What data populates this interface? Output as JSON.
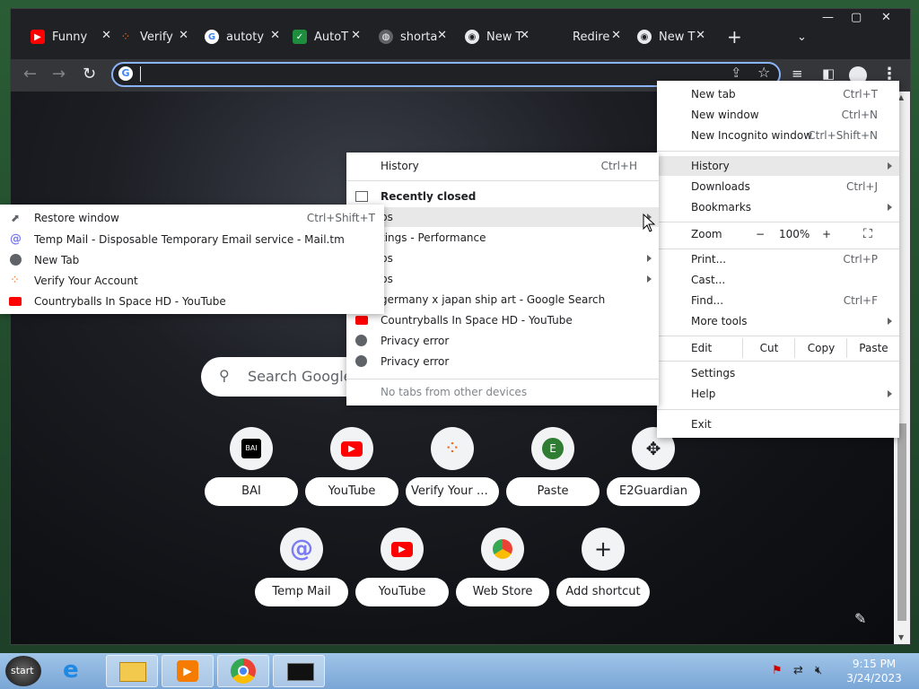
{
  "tabs": [
    {
      "title": "Funny",
      "favicon": "youtube-icon"
    },
    {
      "title": "Verify",
      "favicon": "verify-icon"
    },
    {
      "title": "autoty",
      "favicon": "google-icon"
    },
    {
      "title": "AutoT",
      "favicon": "autot-icon"
    },
    {
      "title": "shorta",
      "favicon": "globe-icon"
    },
    {
      "title": "New T",
      "favicon": "chrome-icon"
    },
    {
      "title": "Redire",
      "favicon": ""
    },
    {
      "title": "New T",
      "favicon": "chrome-icon"
    }
  ],
  "omnibox": {
    "value": ""
  },
  "search": {
    "placeholder": "Search Google o"
  },
  "shortcuts": [
    {
      "label": "BAI",
      "icon": "bai-icon"
    },
    {
      "label": "YouTube",
      "icon": "youtube-icon"
    },
    {
      "label": "Verify Your A...",
      "icon": "verify-icon"
    },
    {
      "label": "Paste",
      "icon": "e-icon",
      "icon_text": "E"
    },
    {
      "label": "E2Guardian",
      "icon": "e2guardian-icon"
    },
    {
      "label": "Temp Mail",
      "icon": "at-icon"
    },
    {
      "label": "YouTube",
      "icon": "youtube-icon"
    },
    {
      "label": "Web Store",
      "icon": "webstore-icon"
    },
    {
      "label": "Add shortcut",
      "icon": "plus-icon"
    }
  ],
  "main_menu": {
    "items": [
      {
        "label": "New tab",
        "shortcut": "Ctrl+T"
      },
      {
        "label": "New window",
        "shortcut": "Ctrl+N"
      },
      {
        "label": "New Incognito window",
        "shortcut": "Ctrl+Shift+N"
      },
      {
        "label": "History",
        "shortcut": ""
      },
      {
        "label": "Downloads",
        "shortcut": "Ctrl+J"
      },
      {
        "label": "Bookmarks",
        "shortcut": ""
      },
      {
        "label": "Print...",
        "shortcut": "Ctrl+P"
      },
      {
        "label": "Cast...",
        "shortcut": ""
      },
      {
        "label": "Find...",
        "shortcut": "Ctrl+F"
      },
      {
        "label": "More tools",
        "shortcut": ""
      },
      {
        "label": "Settings",
        "shortcut": ""
      },
      {
        "label": "Help",
        "shortcut": ""
      },
      {
        "label": "Exit",
        "shortcut": ""
      }
    ],
    "zoom": {
      "label": "Zoom",
      "minus": "−",
      "value": "100%",
      "plus": "+"
    },
    "edit": {
      "label": "Edit",
      "cut": "Cut",
      "copy": "Copy",
      "paste": "Paste"
    }
  },
  "history_menu": {
    "history": {
      "label": "History",
      "shortcut": "Ctrl+H"
    },
    "recently_closed": "Recently closed",
    "items": [
      "bs",
      "tings - Performance",
      "bs",
      "bs",
      "germany x japan ship art - Google Search",
      "Countryballs In Space HD - YouTube",
      "Privacy error",
      "Privacy error"
    ],
    "no_tabs": "No tabs from other devices"
  },
  "submenu": {
    "restore": {
      "label": "Restore window",
      "shortcut": "Ctrl+Shift+T"
    },
    "items": [
      "Temp Mail - Disposable Temporary Email service - Mail.tm",
      "New Tab",
      "Verify Your Account",
      "Countryballs In Space HD - YouTube"
    ]
  },
  "taskbar": {
    "start": "start",
    "time": "9:15 PM",
    "date": "3/24/2023"
  },
  "colors": {
    "youtube": "#ff0000",
    "accent": "#8ab4f8",
    "verify": "#f26b1d"
  }
}
